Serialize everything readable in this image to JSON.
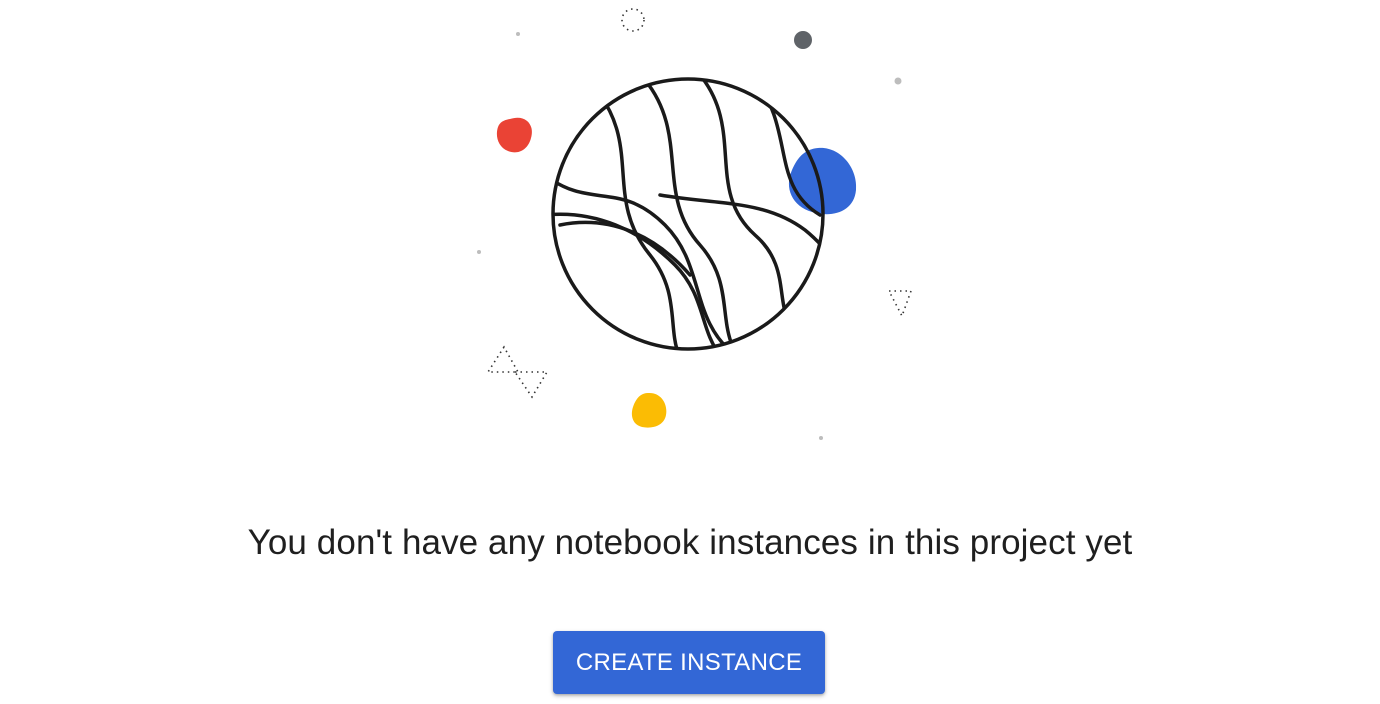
{
  "empty_state": {
    "illustration_icon": "planet-icon",
    "message": "You don't have any notebook instances in this project yet",
    "create_button_label": "CREATE INSTANCE"
  },
  "colors": {
    "accent_blue": "#3367d6",
    "blob_red": "#ea4335",
    "blob_yellow": "#fbbc04",
    "blob_gray": "#5f6368",
    "text": "#1f1f1f"
  }
}
